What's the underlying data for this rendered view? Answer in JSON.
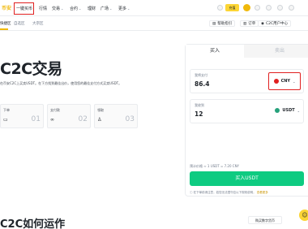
{
  "nav": {
    "logo": "币安",
    "items": [
      "一键买币",
      "行情",
      "交易",
      "合约",
      "理财",
      "广场",
      "更多"
    ],
    "deposit_label": "充值"
  },
  "subnav": {
    "tabs": [
      "快捷区",
      "自选区",
      "大宗区"
    ],
    "right": [
      "帮助指引",
      "订单",
      "C2C用户中心"
    ]
  },
  "hero": {
    "title": "C2C交易",
    "description": "在币安C2C上买卖USDT。在下方找到最佳出价，使用您的最佳支付方式买卖USDT。"
  },
  "steps": [
    {
      "label": "下单",
      "num": "01"
    },
    {
      "label": "支付款",
      "num": "02"
    },
    {
      "label": "领取",
      "num": "03"
    }
  ],
  "panel": {
    "tab_buy": "买入",
    "tab_sell": "卖出",
    "pay_label": "我将支付",
    "pay_value": "86.4",
    "pay_currency": "CNY",
    "receive_label": "我收到",
    "receive_value": "12",
    "receive_currency": "USDT",
    "ref_price": "预计价格 ≈ 1 USDT = 7.20 CNY",
    "buy_button": "买入USDT",
    "notice_text": "在下单前请注意，若您无法遵守应以下规则说明，",
    "notice_link": "查看更多"
  },
  "how": {
    "title": "C2C如何运作",
    "guide_button": "购买数字货币"
  }
}
